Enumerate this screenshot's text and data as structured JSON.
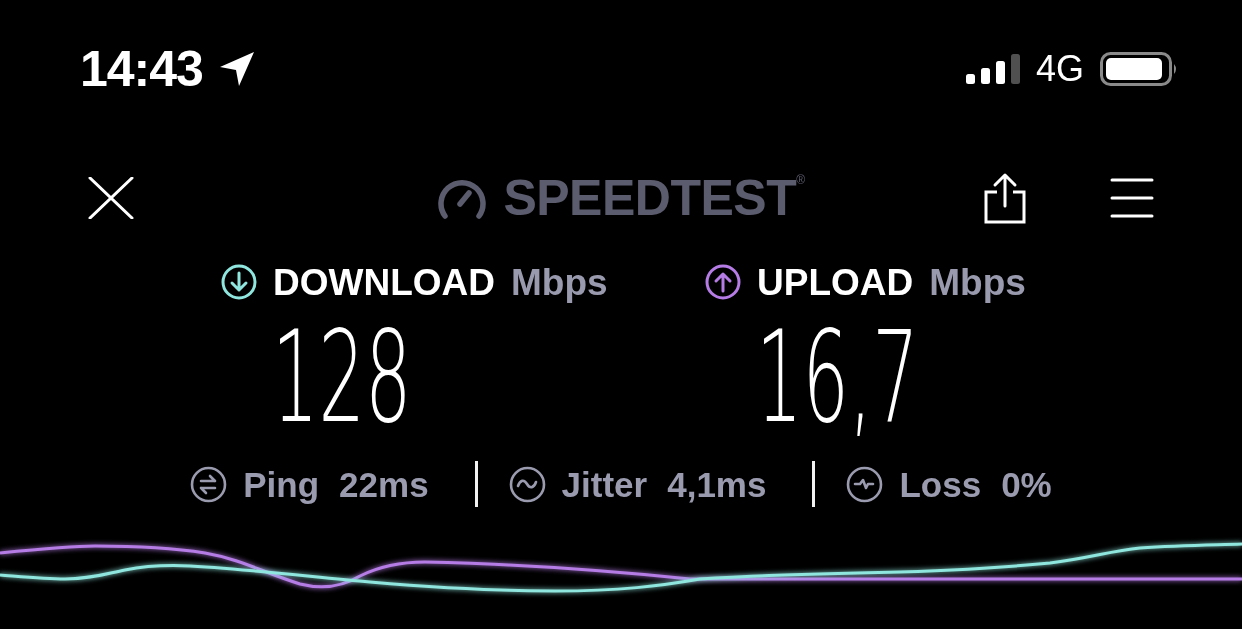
{
  "status_bar": {
    "time": "14:43",
    "network": "4G"
  },
  "header": {
    "logo": "SPEEDTEST$^{®}$"
  },
  "speeds": [
    {
      "kind": "download",
      "label": "DOWNLOAD",
      "unit": "Mbps",
      "value": "128",
      "color": "#8fe6de"
    },
    {
      "kind": "upload",
      "label": "UPLOAD",
      "unit": "Mbps",
      "value": "16,7",
      "color": "#b57ce6"
    }
  ],
  "metrics": [
    {
      "kind": "ping",
      "label": "Ping",
      "value": "22ms"
    },
    {
      "kind": "jitter",
      "label": "Jitter",
      "value": "4,1ms"
    },
    {
      "kind": "loss",
      "label": "Loss",
      "value": "0%"
    }
  ]
}
